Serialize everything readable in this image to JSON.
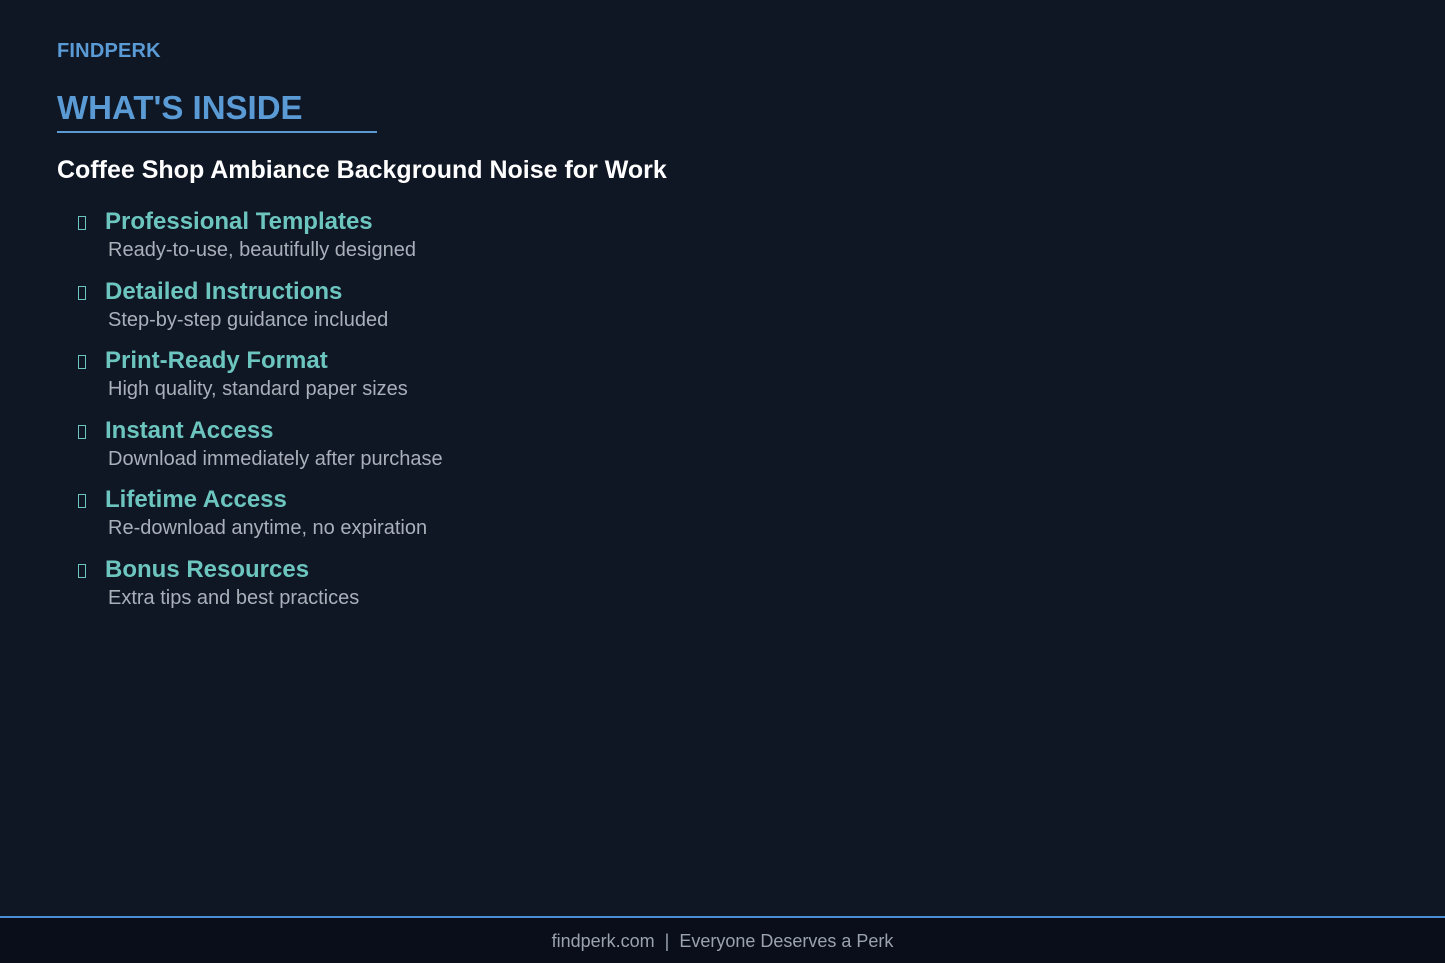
{
  "brand": "FINDPERK",
  "section_title": "WHAT'S INSIDE",
  "product_title": "Coffee Shop Ambiance Background Noise for Work",
  "features": [
    {
      "icon": "checkbox-icon",
      "title": "Professional Templates",
      "description": "Ready-to-use, beautifully designed"
    },
    {
      "icon": "checkbox-icon",
      "title": "Detailed Instructions",
      "description": "Step-by-step guidance included"
    },
    {
      "icon": "checkbox-icon",
      "title": "Print-Ready Format",
      "description": "High quality, standard paper sizes"
    },
    {
      "icon": "checkbox-icon",
      "title": "Instant Access",
      "description": "Download immediately after purchase"
    },
    {
      "icon": "checkbox-icon",
      "title": "Lifetime Access",
      "description": "Re-download anytime, no expiration"
    },
    {
      "icon": "checkbox-icon",
      "title": "Bonus Resources",
      "description": "Extra tips and best practices"
    }
  ],
  "footer": {
    "site": "findperk.com",
    "separator": "|",
    "tagline": "Everyone Deserves a Perk"
  },
  "colors": {
    "background": "#0f1624",
    "accent_blue": "#5b9bd5",
    "accent_teal": "#6cc5be",
    "footer_background": "#0a0e1a"
  }
}
